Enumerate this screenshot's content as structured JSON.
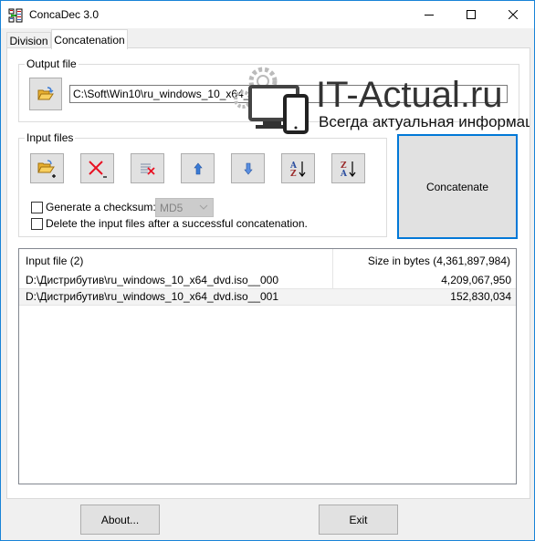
{
  "window": {
    "title": "ConcaDec 3.0",
    "controls": {
      "minimize": "minimize-icon",
      "maximize": "maximize-icon",
      "close": "close-icon"
    }
  },
  "tabs": [
    {
      "label": "Division",
      "active": false
    },
    {
      "label": "Concatenation",
      "active": true
    }
  ],
  "watermark": {
    "brand": "IT-Actual.ru",
    "tagline": "Всегда актуальная информация"
  },
  "output_file": {
    "group_label": "Output file",
    "browse_icon": "folder-open-icon",
    "path": "C:\\Soft\\Win10\\ru_windows_10_x64_dvd.iso"
  },
  "input_files": {
    "group_label": "Input files",
    "toolbar": [
      {
        "name": "add-files",
        "icon": "folder-add-icon"
      },
      {
        "name": "remove-file",
        "icon": "delete-x-icon"
      },
      {
        "name": "clear-list",
        "icon": "clear-list-icon"
      },
      {
        "name": "move-up",
        "icon": "arrow-up-icon"
      },
      {
        "name": "move-down",
        "icon": "arrow-down-icon"
      },
      {
        "name": "sort-ascending",
        "icon": "sort-az-icon"
      },
      {
        "name": "sort-descending",
        "icon": "sort-za-icon"
      }
    ],
    "checksum_label": "Generate a checksum:",
    "checksum_checked": false,
    "checksum_algorithm": "MD5",
    "delete_label": "Delete the input files after a successful concatenation.",
    "delete_checked": false
  },
  "concatenate_label": "Concatenate",
  "file_list": {
    "columns": [
      "Input file (2)",
      "Size in bytes (4,361,897,984)"
    ],
    "rows": [
      {
        "file": "D:\\Дистрибутив\\ru_windows_10_x64_dvd.iso__000",
        "size": "4,209,067,950"
      },
      {
        "file": "D:\\Дистрибутив\\ru_windows_10_x64_dvd.iso__001",
        "size": "152,830,034"
      }
    ]
  },
  "footer": {
    "about_label": "About...",
    "exit_label": "Exit"
  },
  "colors": {
    "accent": "#0078d7",
    "window_border": "#1883d7",
    "delete_red": "#e81123",
    "arrow_blue": "#3a7bd5"
  }
}
